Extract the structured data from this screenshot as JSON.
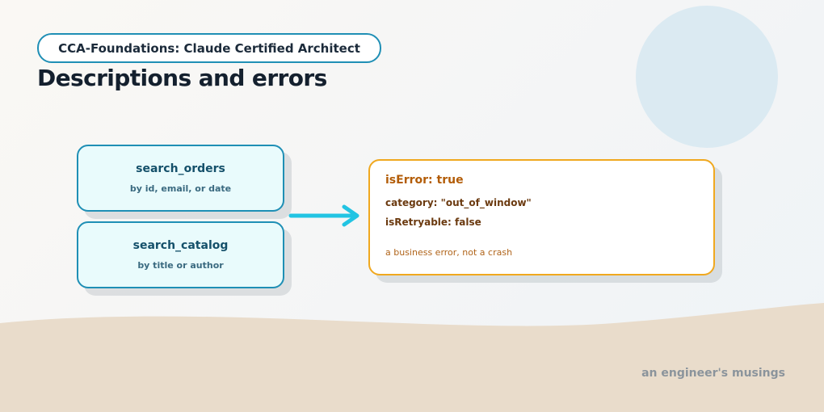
{
  "header": {
    "series_badge": "CCA-Foundations: Claude Certified Architect",
    "title": "Descriptions and errors"
  },
  "tools": [
    {
      "name": "search_orders",
      "description": "by id, email, or date"
    },
    {
      "name": "search_catalog",
      "description": "by title or author"
    }
  ],
  "error_result": {
    "title": "isError: true",
    "category_line": "category: \"out_of_window\"",
    "retryable_line": "isRetryable: false",
    "note": "a business error, not a crash"
  },
  "footer": {
    "signature": "an engineer's musings"
  },
  "colors": {
    "tool_border": "#1f8fb5",
    "tool_fill": "#e9fbfc",
    "error_border": "#f0a81f",
    "arrow": "#22c4e3",
    "sand": "#e9dccb"
  }
}
